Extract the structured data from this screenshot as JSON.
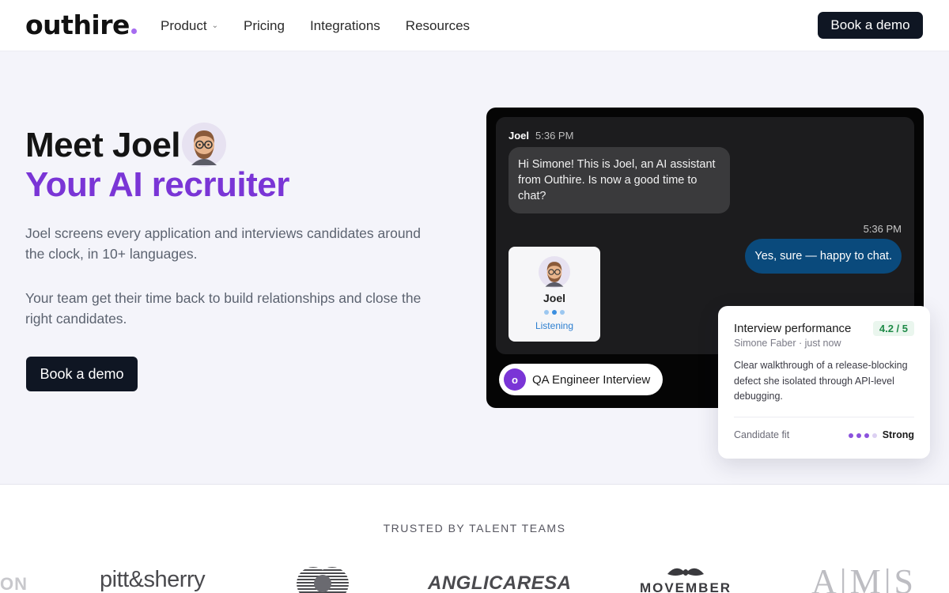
{
  "nav": {
    "logo": "outhire",
    "links": [
      {
        "label": "Product",
        "has_dropdown": true
      },
      {
        "label": "Pricing"
      },
      {
        "label": "Integrations"
      },
      {
        "label": "Resources"
      }
    ],
    "cta": "Book a demo"
  },
  "hero": {
    "title_line1": "Meet Joel",
    "title_line2": "Your AI recruiter",
    "paragraph1": "Joel screens every application and interviews candidates around the clock, in 10+ languages.",
    "paragraph2": "Your team get their time back to build relationships and close the right candidates.",
    "cta": "Book a demo"
  },
  "chat": {
    "sender": "Joel",
    "sender_time": "5:36 PM",
    "incoming_message": "Hi Simone! This is Joel, an AI assistant from Outhire. Is now a good time to chat?",
    "reply_time": "5:36 PM",
    "reply_message": "Yes, sure — happy to chat.",
    "agent_card": {
      "name": "Joel",
      "status": "Listening"
    },
    "interview_badge_letter": "o",
    "interview_label": "QA Engineer Interview"
  },
  "performance": {
    "title": "Interview performance",
    "score": "4.2 / 5",
    "subtitle": "Simone Faber · just now",
    "summary": "Clear walkthrough of a release-blocking defect she isolated through API-level debugging.",
    "fit_label": "Candidate fit",
    "fit_level": 3,
    "fit_max": 4,
    "fit_value": "Strong"
  },
  "trusted": {
    "heading": "TRUSTED BY TALENT TEAMS",
    "logos": [
      "ON",
      "pitt&sherry",
      "mastercard-mark",
      "ANGLICARESA",
      "MOVEMBER",
      "A|M|S"
    ]
  },
  "colors": {
    "accent": "#7a35d6",
    "dark": "#0f1623",
    "reply_bubble": "#0a4a7c",
    "score_green": "#1e8a47"
  }
}
